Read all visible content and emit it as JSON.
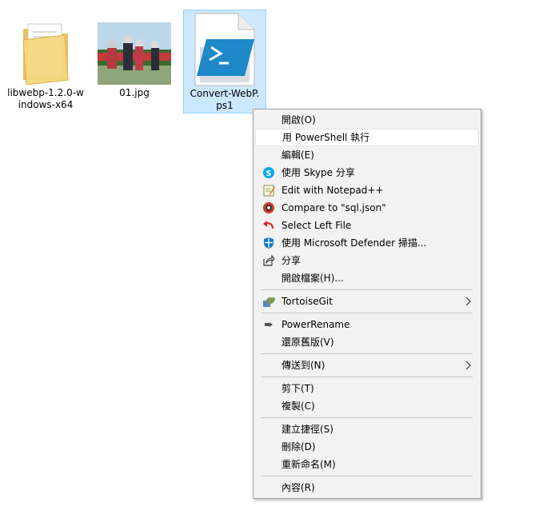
{
  "desktop": {
    "items": [
      {
        "label": "libwebp-1.2.0-windows-x64",
        "type": "folder"
      },
      {
        "label": "01.jpg",
        "type": "image"
      },
      {
        "label": "Convert-WebP.ps1",
        "type": "powershell-script"
      }
    ]
  },
  "context_menu": {
    "items": [
      {
        "label": "開啟(O)",
        "icon": ""
      },
      {
        "label": "用 PowerShell 執行",
        "icon": ""
      },
      {
        "label": "編輯(E)",
        "icon": ""
      },
      {
        "label": "使用 Skype 分享",
        "icon": "skype-icon"
      },
      {
        "label": "Edit with Notepad++",
        "icon": "notepad-plus-plus-icon"
      },
      {
        "label": "Compare to \"sql.json\"",
        "icon": "beyond-compare-icon"
      },
      {
        "label": "Select Left File",
        "icon": "undo-arrow-icon"
      },
      {
        "label": "使用 Microsoft Defender 掃描...",
        "icon": "defender-shield-icon"
      },
      {
        "label": "分享",
        "icon": "share-icon"
      },
      {
        "label": "開啟檔案(H)...",
        "icon": ""
      },
      {
        "label": "TortoiseGit",
        "icon": "tortoisegit-icon",
        "submenu": true
      },
      {
        "label": "PowerRename",
        "icon": "powerrename-icon"
      },
      {
        "label": "還原舊版(V)",
        "icon": ""
      },
      {
        "label": "傳送到(N)",
        "icon": "",
        "submenu": true
      },
      {
        "label": "剪下(T)",
        "icon": ""
      },
      {
        "label": "複製(C)",
        "icon": ""
      },
      {
        "label": "建立捷徑(S)",
        "icon": ""
      },
      {
        "label": "刪除(D)",
        "icon": ""
      },
      {
        "label": "重新命名(M)",
        "icon": ""
      },
      {
        "label": "內容(R)",
        "icon": ""
      }
    ],
    "highlighted_item": "用 PowerShell 執行"
  },
  "colors": {
    "selection_bg": "#cce8ff",
    "selection_border": "#99d1ff",
    "menu_bg": "#f2f2f2",
    "powershell_blue": "#1e88c8"
  }
}
